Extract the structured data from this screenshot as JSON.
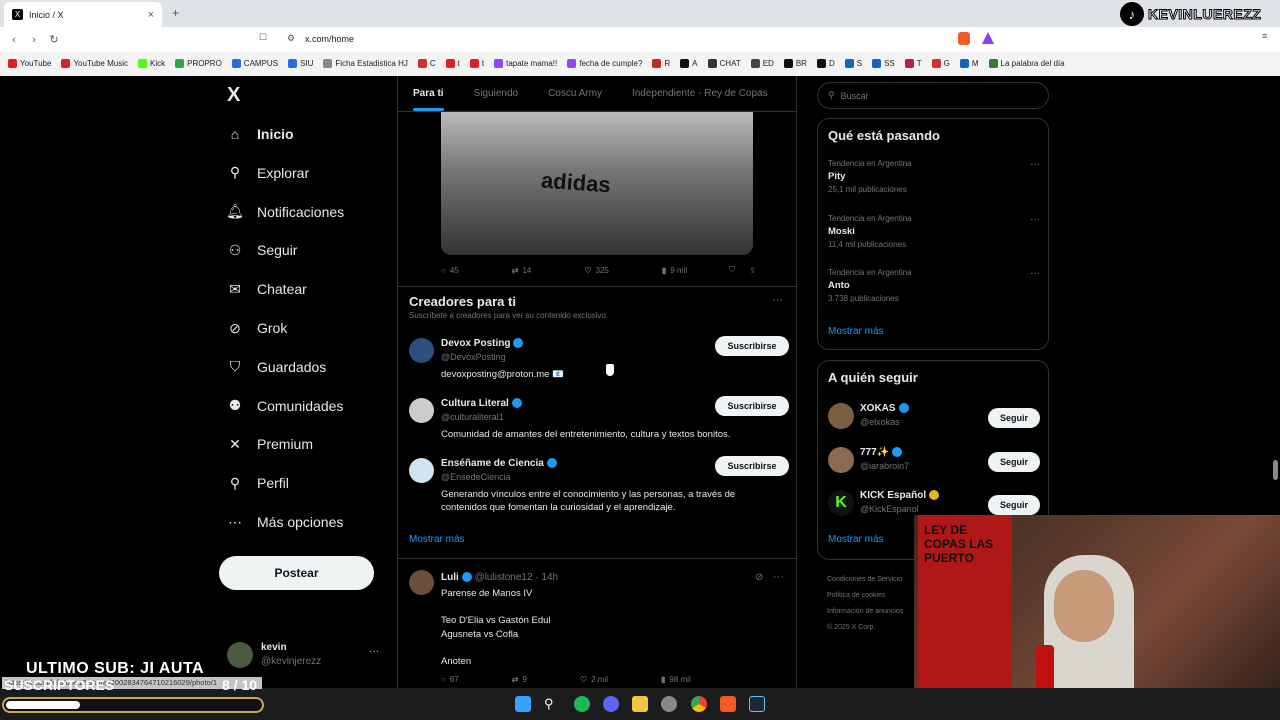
{
  "browser": {
    "tab_title": "Inicio / X",
    "tab_close": "×",
    "new_tab": "+",
    "url": "x.com/home",
    "bookmarks": [
      {
        "label": "YouTube",
        "color": "#e02020"
      },
      {
        "label": "YouTube Music",
        "color": "#e02020"
      },
      {
        "label": "Kick",
        "color": "#53fc18"
      },
      {
        "label": "PROPRO",
        "color": "#2aa84a"
      },
      {
        "label": "CAMPUS",
        "color": "#2a6dd6"
      },
      {
        "label": "SIU",
        "color": "#2a6dd6"
      },
      {
        "label": "Ficha Estadistica HJ",
        "color": "#888888"
      },
      {
        "label": "C",
        "color": "#d32f2f"
      },
      {
        "label": "t",
        "color": "#e02020"
      },
      {
        "label": "t",
        "color": "#e02020"
      },
      {
        "label": "tapate mama!!",
        "color": "#9146ff"
      },
      {
        "label": "fecha de cumple?",
        "color": "#9146ff"
      },
      {
        "label": "R",
        "color": "#c62828"
      },
      {
        "label": "A",
        "color": "#111111"
      },
      {
        "label": "CHAT",
        "color": "#333333"
      },
      {
        "label": "ED",
        "color": "#444444"
      },
      {
        "label": "BR",
        "color": "#111111"
      },
      {
        "label": "D",
        "color": "#111111"
      },
      {
        "label": "S",
        "color": "#1565c0"
      },
      {
        "label": "SS",
        "color": "#1565c0"
      },
      {
        "label": "T",
        "color": "#c2185b"
      },
      {
        "label": "G",
        "color": "#d32f2f"
      },
      {
        "label": "M",
        "color": "#1565c0"
      },
      {
        "label": "La palabra del día",
        "color": "#2e7d32"
      }
    ]
  },
  "overlay": {
    "tiktok_name": "KEVINLUEREZZ",
    "last_sub": "ULTIMO SUB: JI AUTA",
    "subs_label": "SUSCRIPTORES",
    "subs_count": "8 / 10",
    "subs_progress": 0.29,
    "status_url": "https://x.com/lulistone12/status/2002834764710216029/photo/1"
  },
  "x": {
    "logo": "X",
    "nav": [
      {
        "label": "Inicio",
        "icon": "home-icon",
        "glyph": "⌂",
        "active": true
      },
      {
        "label": "Explorar",
        "icon": "search-icon",
        "glyph": "⚲"
      },
      {
        "label": "Notificaciones",
        "icon": "bell-icon",
        "glyph": "🔔︎"
      },
      {
        "label": "Seguir",
        "icon": "person-plus-icon",
        "glyph": "⚇"
      },
      {
        "label": "Chatear",
        "icon": "mail-icon",
        "glyph": "✉"
      },
      {
        "label": "Grok",
        "icon": "grok-icon",
        "glyph": "⊘"
      },
      {
        "label": "Guardados",
        "icon": "bookmark-icon",
        "glyph": "⛉"
      },
      {
        "label": "Comunidades",
        "icon": "people-icon",
        "glyph": "⚉"
      },
      {
        "label": "Premium",
        "icon": "x-icon",
        "glyph": "✕"
      },
      {
        "label": "Perfil",
        "icon": "person-icon",
        "glyph": "⚲"
      },
      {
        "label": "Más opciones",
        "icon": "more-circle-icon",
        "glyph": "⋯"
      }
    ],
    "post_button": "Postear",
    "account": {
      "name": "kevin",
      "handle": "@kevinjerezz",
      "more": "···"
    },
    "tabs": [
      "Para ti",
      "Siguiendo",
      "Coscu Army",
      "Independiente - Rey de Copas"
    ],
    "image_text": "adidas",
    "top_tweet_actions": {
      "replies": "45",
      "reposts": "14",
      "likes": "325",
      "views": "9 mil"
    },
    "creators": {
      "title": "Creadores para ti",
      "subtitle": "Suscríbete a creadores para ver su contenido exclusivo.",
      "button": "Suscribirse",
      "items": [
        {
          "name": "Devox Posting",
          "handle": "@DevoxPosting",
          "bio": "devoxposting@proton.me 📧"
        },
        {
          "name": "Cultura Literal",
          "handle": "@culturaliteral1",
          "bio": "Comunidad de amantes del entretenimiento, cultura y textos bonitos."
        },
        {
          "name": "Enséñame de Ciencia",
          "handle": "@EnsedeCiencia",
          "bio": "Generando vínculos entre el conocimiento y las personas, a través de contenidos que fomentan la curiosidad y el aprendizaje."
        }
      ],
      "more": "Mostrar más"
    },
    "tweet": {
      "name": "Luli",
      "handle": "@lulistone12 · 14h",
      "body": "Parense de Manos IV\n\nTeo D'Elia vs Gastón Edul\nAgusneta vs Cofla\n\nAnoten",
      "replies": "67",
      "reposts": "9",
      "likes": "2 mil",
      "views": "98 mil"
    },
    "search_placeholder": "Buscar",
    "trends": {
      "title": "Qué está pasando",
      "items": [
        {
          "category": "Tendencia en Argentina",
          "topic": "Pity",
          "count": "25,1 mil publicaciones"
        },
        {
          "category": "Tendencia en Argentina",
          "topic": "Moski",
          "count": "11,4 mil publicaciones"
        },
        {
          "category": "Tendencia en Argentina",
          "topic": "Anto",
          "count": "3.738 publicaciones"
        }
      ],
      "more": "Mostrar más"
    },
    "who_to_follow": {
      "title": "A quién seguir",
      "button": "Seguir",
      "items": [
        {
          "name": "XOKAS",
          "handle": "@elxokas"
        },
        {
          "name": "777✨",
          "handle": "@iarabroin7"
        },
        {
          "name": "KICK Español",
          "handle": "@KickEspanol"
        }
      ],
      "more": "Mostrar más"
    },
    "footer": [
      "Condiciones de Servicio",
      "Política de cookies",
      "Información de anuncios",
      "© 2025 X Corp."
    ]
  },
  "webcam": {
    "flag_text": "LEY DE COPAS LAS PUERTO"
  }
}
